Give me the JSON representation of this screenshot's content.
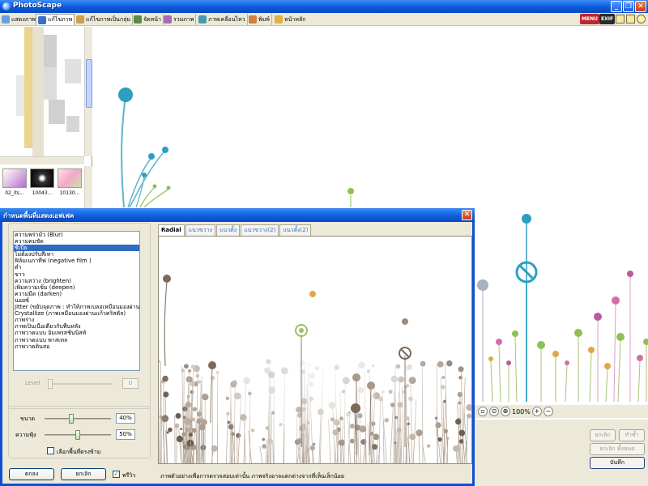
{
  "window": {
    "title": "PhotoScape"
  },
  "toolbar": {
    "tabs": [
      {
        "label": "แสดงภาพ",
        "icon": "viewer-icon"
      },
      {
        "label": "แก้ไขภาพ",
        "icon": "editor-icon"
      },
      {
        "label": "แก้ไขภาพเป็นกลุ่ม",
        "icon": "batch-editor-icon"
      },
      {
        "label": "จัดหน้า",
        "icon": "page-icon"
      },
      {
        "label": "รวมภาพ",
        "icon": "combine-icon"
      },
      {
        "label": "ภาพเคลื่อนไหว",
        "icon": "animated-gif-icon"
      },
      {
        "label": "พิมพ์",
        "icon": "print-icon"
      },
      {
        "label": "หน้าหลัก",
        "icon": "home-icon"
      }
    ],
    "menu_badge": "MENU",
    "exif_badge": "EXIF"
  },
  "thumbnails": [
    {
      "label": "02_its..."
    },
    {
      "label": "10043..."
    },
    {
      "label": "10130..."
    }
  ],
  "zoom": {
    "level": "100%"
  },
  "side_buttons": {
    "undo": "ยกเลิก",
    "redo": "ทำซ้ำ",
    "undo_all": "ยกเลิก ทั้งหมด",
    "save": "บันทึก"
  },
  "dialog": {
    "title": "กำหนดพื้นที่แสดงเอฟเฟค",
    "effects": [
      "ความพร่ามัว (Blur)",
      "ความคมชัด",
      "ซีเปีย",
      "ไม่ต้องปรับสีเทา",
      "ฟิล์มเนกาทีฟ (negative film )",
      "ดำ",
      "ขาว",
      "ความสว่าง (brighten)",
      "เพิ่มความเข้ม (deepen)",
      "ความมืด (darken)",
      "นอยซ์",
      "Jitter (ขยับจุดภาพ : ทำให้ภาพเบลอเหมือนมองผ่านกระจก)",
      "Crystallize (ภาพเหมือนมองผ่านแก้วคริสตัล)",
      "ภาพร่าง",
      "ภาพเป็นเนื้อเดียวกับพื้นหลัง",
      "ภาพวาดแบบ อิมเพรสชั่นนิสท์",
      "ภาพวาดแบบ พาสเทล",
      "ภาพวาดดินสอ"
    ],
    "selected_index": 2,
    "level_label": "Level",
    "level_value": "0",
    "size_label": "ขนาด",
    "size_value": "40%",
    "size_fraction": 0.4,
    "softness_label": "ความฟุ้ง",
    "softness_value": "50%",
    "softness_fraction": 0.5,
    "invert_label": "เลือกพื้นที่ตรงข้าม",
    "ok_label": "ตกลง",
    "cancel_label": "ยกเลิก",
    "preview_label": "พรีวิว",
    "preview_checked": true,
    "preview_tabs": [
      "Radial",
      "แนวขวาง",
      "แนวตั้ง",
      "แนวขวาง(2)",
      "แนวตั้ง(2)"
    ],
    "note": "ภาพตัวอย่างเพื่อการตรวจสอบเท่านั้น ภาพจริงอาจแตกต่างจากที่เห็นเล็กน้อย"
  },
  "colors": {
    "accent_blue": "#0a5bdc",
    "selection": "#316ac5",
    "dialog_bg": "#ece9d8"
  }
}
